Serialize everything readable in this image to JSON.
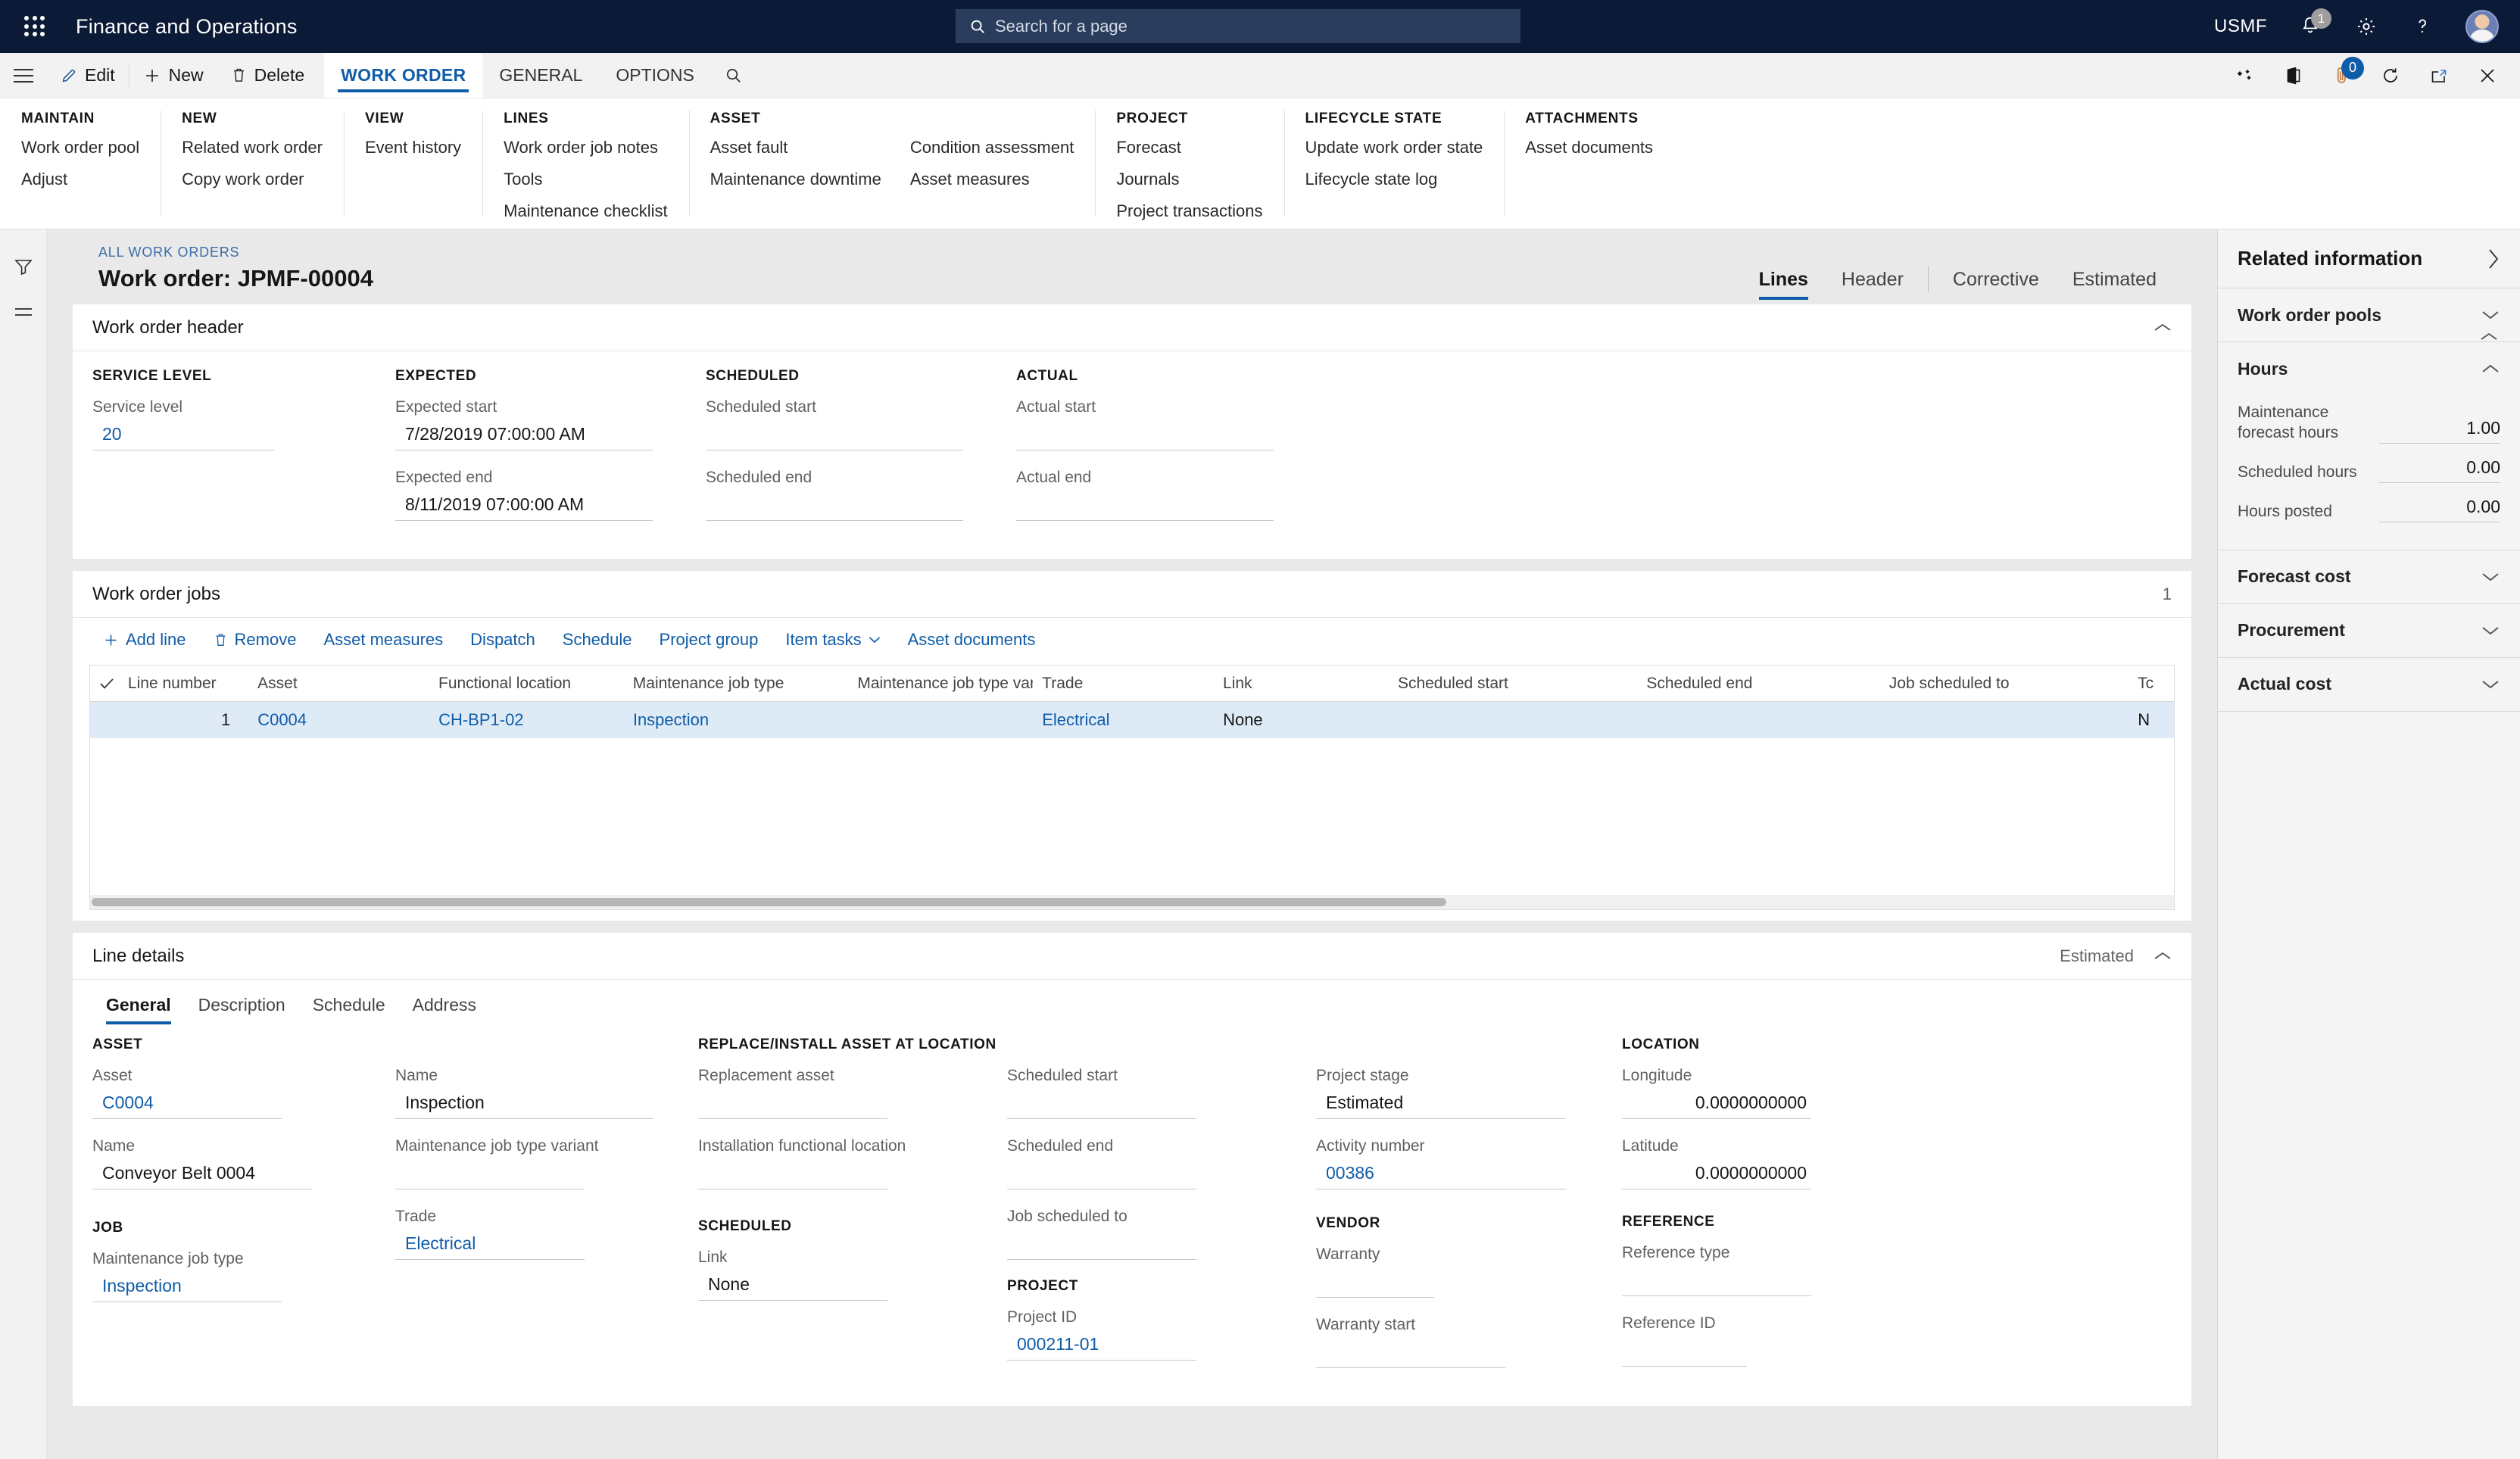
{
  "topnav": {
    "app_title": "Finance and Operations",
    "search_placeholder": "Search for a page",
    "company": "USMF",
    "notification_count": "1",
    "icons": {
      "waffle": "app-launcher-icon",
      "search": "search-icon",
      "bell": "notifications-icon",
      "gear": "settings-icon",
      "help": "help-icon",
      "avatar": "user-avatar"
    }
  },
  "cmdbar": {
    "edit": "Edit",
    "new": "New",
    "delete": "Delete",
    "tabs": [
      {
        "label": "WORK ORDER",
        "active": true
      },
      {
        "label": "GENERAL",
        "active": false
      },
      {
        "label": "OPTIONS",
        "active": false
      }
    ],
    "search_icon": "search-icon",
    "attachment_count": "0"
  },
  "ribbon": {
    "groups": [
      {
        "title": "MAINTAIN",
        "columns": [
          [
            "Work order pool",
            "Adjust"
          ]
        ]
      },
      {
        "title": "NEW",
        "columns": [
          [
            "Related work order",
            "Copy work order"
          ]
        ]
      },
      {
        "title": "VIEW",
        "columns": [
          [
            "Event history"
          ]
        ]
      },
      {
        "title": "LINES",
        "columns": [
          [
            "Work order job notes",
            "Tools",
            "Maintenance checklist"
          ]
        ]
      },
      {
        "title": "ASSET",
        "columns": [
          [
            "Asset fault",
            "Maintenance downtime"
          ],
          [
            "Condition assessment",
            "Asset measures"
          ]
        ]
      },
      {
        "title": "PROJECT",
        "columns": [
          [
            "Forecast",
            "Journals",
            "Project transactions"
          ]
        ]
      },
      {
        "title": "LIFECYCLE STATE",
        "columns": [
          [
            "Update work order state",
            "Lifecycle state log"
          ]
        ]
      },
      {
        "title": "ATTACHMENTS",
        "columns": [
          [
            "Asset documents"
          ]
        ]
      }
    ]
  },
  "page": {
    "breadcrumb": "ALL WORK ORDERS",
    "title": "Work order: JPMF-00004",
    "tabs": [
      {
        "label": "Lines",
        "active": true
      },
      {
        "label": "Header",
        "active": false
      },
      {
        "label": "Corrective",
        "active": false
      },
      {
        "label": "Estimated",
        "active": false
      }
    ]
  },
  "work_order_header": {
    "title": "Work order header",
    "groups": [
      {
        "title": "SERVICE LEVEL",
        "fields": [
          {
            "label": "Service level",
            "value": "20",
            "link": true
          }
        ]
      },
      {
        "title": "EXPECTED",
        "fields": [
          {
            "label": "Expected start",
            "value": "7/28/2019 07:00:00 AM",
            "link": false
          },
          {
            "label": "Expected end",
            "value": "8/11/2019 07:00:00 AM",
            "link": false
          }
        ]
      },
      {
        "title": "SCHEDULED",
        "fields": [
          {
            "label": "Scheduled start",
            "value": "",
            "link": false
          },
          {
            "label": "Scheduled end",
            "value": "",
            "link": false
          }
        ]
      },
      {
        "title": "ACTUAL",
        "fields": [
          {
            "label": "Actual start",
            "value": "",
            "link": false
          },
          {
            "label": "Actual end",
            "value": "",
            "link": false
          }
        ]
      }
    ]
  },
  "work_order_jobs": {
    "title": "Work order jobs",
    "count": "1",
    "toolbar": [
      {
        "label": "Add line",
        "icon": "plus-icon"
      },
      {
        "label": "Remove",
        "icon": "trash-icon"
      },
      {
        "label": "Asset measures",
        "icon": ""
      },
      {
        "label": "Dispatch",
        "icon": ""
      },
      {
        "label": "Schedule",
        "icon": ""
      },
      {
        "label": "Project group",
        "icon": ""
      },
      {
        "label": "Item tasks",
        "icon": "chevron-down-icon"
      },
      {
        "label": "Asset documents",
        "icon": ""
      }
    ],
    "columns": [
      "Line number",
      "Asset",
      "Functional location",
      "Maintenance job type",
      "Maintenance job type varia...",
      "Trade",
      "Link",
      "Scheduled start",
      "Scheduled end",
      "Job scheduled to",
      "Tc"
    ],
    "rows": [
      {
        "line_number": "1",
        "asset": "C0004",
        "functional_location": "CH-BP1-02",
        "maintenance_job_type": "Inspection",
        "maintenance_job_type_variant": "",
        "trade": "Electrical",
        "link": "None",
        "scheduled_start": "",
        "scheduled_end": "",
        "job_scheduled_to": "",
        "tc": "N"
      }
    ]
  },
  "line_details": {
    "title": "Line details",
    "status": "Estimated",
    "tabs": [
      {
        "label": "General",
        "active": true
      },
      {
        "label": "Description",
        "active": false
      },
      {
        "label": "Schedule",
        "active": false
      },
      {
        "label": "Address",
        "active": false
      }
    ],
    "columns": [
      {
        "sections": [
          {
            "title": "ASSET",
            "fields": [
              {
                "label": "Asset",
                "value": "C0004",
                "link": true
              },
              {
                "label": "Name",
                "value": "Conveyor Belt 0004",
                "link": false
              }
            ]
          },
          {
            "title": "JOB",
            "fields": [
              {
                "label": "Maintenance job type",
                "value": "Inspection",
                "link": true
              }
            ]
          }
        ]
      },
      {
        "sections": [
          {
            "title": "",
            "fields": [
              {
                "label": "Name",
                "value": "Inspection",
                "link": false
              },
              {
                "label": "Maintenance job type variant",
                "value": "",
                "link": false
              },
              {
                "label": "Trade",
                "value": "Electrical",
                "link": true
              }
            ]
          }
        ]
      },
      {
        "sections": [
          {
            "title": "REPLACE/INSTALL ASSET AT LOCATION",
            "fields": [
              {
                "label": "Replacement asset",
                "value": "",
                "link": false
              },
              {
                "label": "Installation functional location",
                "value": "",
                "link": false
              }
            ]
          },
          {
            "title": "SCHEDULED",
            "fields": [
              {
                "label": "Link",
                "value": "None",
                "link": false
              }
            ]
          }
        ]
      },
      {
        "sections": [
          {
            "title": "",
            "fields": [
              {
                "label": "Scheduled start",
                "value": "",
                "link": false
              },
              {
                "label": "Scheduled end",
                "value": "",
                "link": false
              },
              {
                "label": "Job scheduled to",
                "value": "",
                "link": false
              }
            ]
          },
          {
            "title": "PROJECT",
            "fields": [
              {
                "label": "Project ID",
                "value": "000211-01",
                "link": true
              }
            ]
          }
        ]
      },
      {
        "sections": [
          {
            "title": "",
            "fields": [
              {
                "label": "Project stage",
                "value": "Estimated",
                "link": false
              },
              {
                "label": "Activity number",
                "value": "00386",
                "link": true
              }
            ]
          },
          {
            "title": "VENDOR",
            "fields": [
              {
                "label": "Warranty",
                "value": "",
                "link": false
              },
              {
                "label": "Warranty start",
                "value": "",
                "link": false
              }
            ]
          }
        ]
      },
      {
        "sections": [
          {
            "title": "LOCATION",
            "fields": [
              {
                "label": "Longitude",
                "value": "0.0000000000",
                "link": false,
                "numeric": true
              },
              {
                "label": "Latitude",
                "value": "0.0000000000",
                "link": false,
                "numeric": true
              }
            ]
          },
          {
            "title": "REFERENCE",
            "fields": [
              {
                "label": "Reference type",
                "value": "",
                "link": false
              },
              {
                "label": "Reference ID",
                "value": "",
                "link": false
              }
            ]
          }
        ]
      }
    ]
  },
  "related_information": {
    "title": "Related information",
    "sections": [
      {
        "name": "Work order pools",
        "expanded": false,
        "rows": []
      },
      {
        "name": "Hours",
        "expanded": true,
        "rows": [
          {
            "label": "Maintenance forecast hours",
            "value": "1.00"
          },
          {
            "label": "Scheduled hours",
            "value": "0.00"
          },
          {
            "label": "Hours posted",
            "value": "0.00"
          }
        ]
      },
      {
        "name": "Forecast cost",
        "expanded": false,
        "rows": []
      },
      {
        "name": "Procurement",
        "expanded": false,
        "rows": []
      },
      {
        "name": "Actual cost",
        "expanded": false,
        "rows": []
      }
    ]
  },
  "colors": {
    "nav_background": "#0b1a37",
    "accent_link": "#0f5ca8",
    "page_background": "#e9e9e9",
    "row_selected": "#deebf7"
  }
}
